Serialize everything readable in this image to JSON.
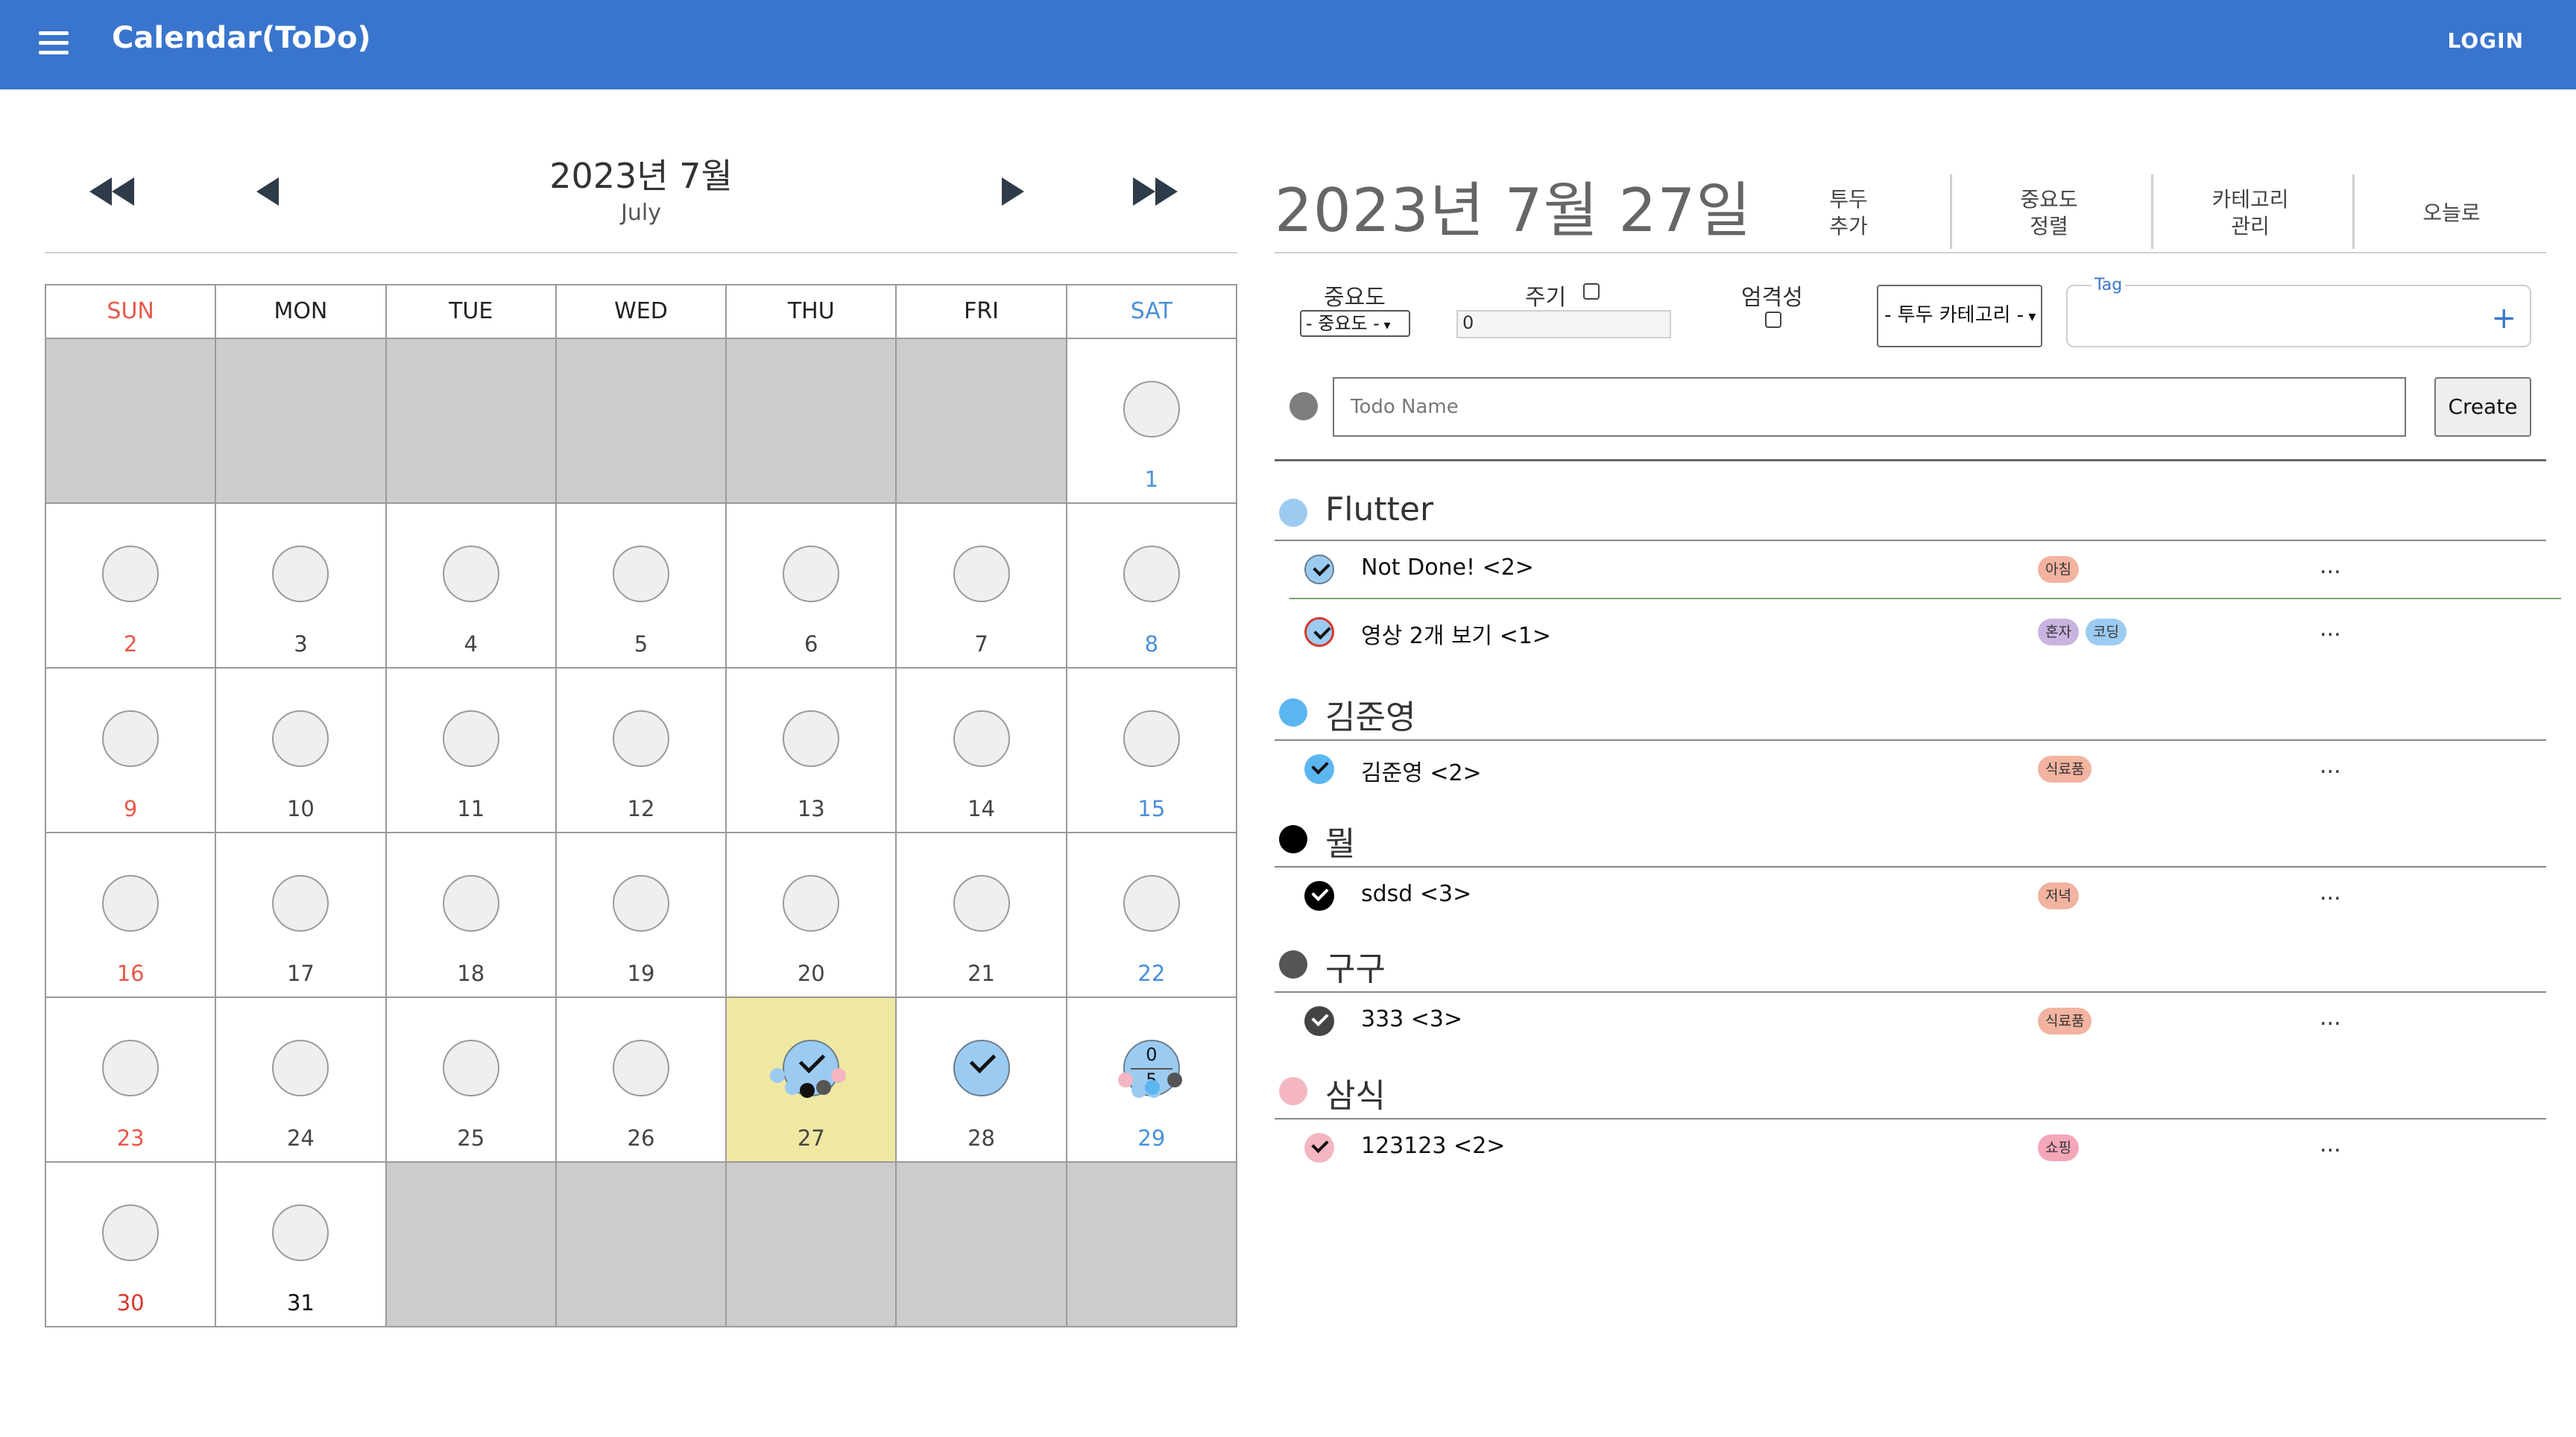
{
  "appbar": {
    "title": "Calendar(ToDo)",
    "login": "LOGIN",
    "color": "#3a75cd"
  },
  "calendar": {
    "month_title": "2023년 7월",
    "month_sub": "July",
    "weekdays": [
      "SUN",
      "MON",
      "TUE",
      "WED",
      "THU",
      "FRI",
      "SAT"
    ],
    "weeks": [
      [
        null,
        null,
        null,
        null,
        null,
        null,
        "1"
      ],
      [
        "2",
        "3",
        "4",
        "5",
        "6",
        "7",
        "8"
      ],
      [
        "9",
        "10",
        "11",
        "12",
        "13",
        "14",
        "15"
      ],
      [
        "16",
        "17",
        "18",
        "19",
        "20",
        "21",
        "22"
      ],
      [
        "23",
        "24",
        "25",
        "26",
        "27",
        "28",
        "29"
      ],
      [
        "30",
        "31",
        null,
        null,
        null,
        null,
        null
      ]
    ],
    "selected_day": "27",
    "done_days": [
      "27",
      "28"
    ],
    "day29_counts": {
      "top": "0",
      "bottom": "5"
    },
    "colors": {
      "sunday": "#e8584a",
      "saturday": "#4a90d9",
      "today_bg": "#efe8a2",
      "empty_bg": "#cccccc"
    }
  },
  "panel": {
    "date_title": "2023년 7월 27일",
    "toolbar": [
      {
        "line1": "투두",
        "line2": "추가"
      },
      {
        "line1": "중요도",
        "line2": "정렬"
      },
      {
        "line1": "카테고리",
        "line2": "관리"
      },
      {
        "line1": "오늘로",
        "line2": ""
      }
    ],
    "form": {
      "importance_label": "중요도",
      "importance_select": "- 중요도 -",
      "cycle_label": "주기",
      "cycle_value": "0",
      "strict_label": "엄격성",
      "category_select": "- 투두 카테고리 -",
      "tag_label": "Tag",
      "todo_placeholder": "Todo Name",
      "create_label": "Create"
    },
    "groups": [
      {
        "name": "Flutter",
        "color": "#9ccbf2",
        "items": [
          {
            "name": "Not Done! <2>",
            "check": "light",
            "tags": [
              {
                "text": "아침",
                "color": "#f2b3a0"
              }
            ],
            "more": "..."
          },
          {
            "name": "영상 2개 보기 <1>",
            "check": "red",
            "tags": [
              {
                "text": "혼자",
                "color": "#c9b3e0"
              },
              {
                "text": "코딩",
                "color": "#9ccbf2"
              }
            ],
            "more": "..."
          }
        ]
      },
      {
        "name": "김준영",
        "color": "#5bb6f0",
        "items": [
          {
            "name": "김준영 <2>",
            "check": "blue",
            "tags": [
              {
                "text": "식료품",
                "color": "#f2b3a0"
              }
            ],
            "more": "..."
          }
        ]
      },
      {
        "name": "뭘",
        "color": "#000000",
        "items": [
          {
            "name": "sdsd <3>",
            "check": "black",
            "tags": [
              {
                "text": "저녁",
                "color": "#f2b3a0"
              }
            ],
            "more": "..."
          }
        ]
      },
      {
        "name": "구구",
        "color": "#555555",
        "items": [
          {
            "name": "333 <3>",
            "check": "gray",
            "tags": [
              {
                "text": "식료품",
                "color": "#f2b3a0"
              }
            ],
            "more": "..."
          }
        ]
      },
      {
        "name": "삼식",
        "color": "#f4b6c2",
        "items": [
          {
            "name": "123123 <2>",
            "check": "pink",
            "tags": [
              {
                "text": "쇼핑",
                "color": "#f4a7b9"
              }
            ],
            "more": "..."
          }
        ]
      }
    ]
  }
}
